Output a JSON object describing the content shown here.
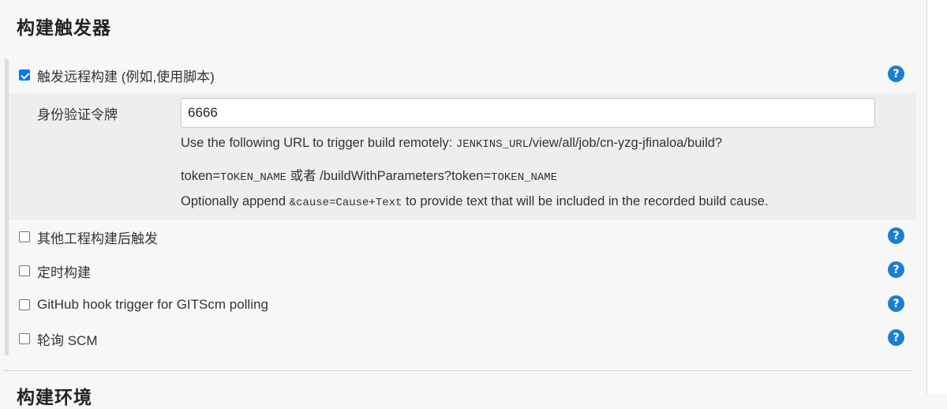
{
  "section": {
    "title": "构建触发器",
    "next_title": "构建环境"
  },
  "triggers": [
    {
      "label": "触发远程构建 (例如,使用脚本)",
      "checked": true
    },
    {
      "label": "其他工程构建后触发",
      "checked": false
    },
    {
      "label": "定时构建",
      "checked": false
    },
    {
      "label": "GitHub hook trigger for GITScm polling",
      "checked": false
    },
    {
      "label": "轮询 SCM",
      "checked": false
    }
  ],
  "help_icon": "?",
  "remote": {
    "token_label": "身份验证令牌",
    "token_value": "6666",
    "desc1_text": "Use the following URL to trigger build remotely: ",
    "desc1_code_a": "JENKINS_URL",
    "desc1_path": "/view/all/job/cn-yzg-jfinaloa/build?",
    "desc2_text_a": "token=",
    "desc2_code_a": "TOKEN_NAME",
    "desc2_mid": " 或者 /buildWithParameters?token=",
    "desc2_code_b": "TOKEN_NAME",
    "desc3_pre": "Optionally append ",
    "desc3_code": "&cause=Cause+Text",
    "desc3_post": " to provide text that will be included in the recorded build cause."
  },
  "colors": {
    "accent": "#1b7fd1",
    "checkbox_checked": "#0075ff"
  }
}
